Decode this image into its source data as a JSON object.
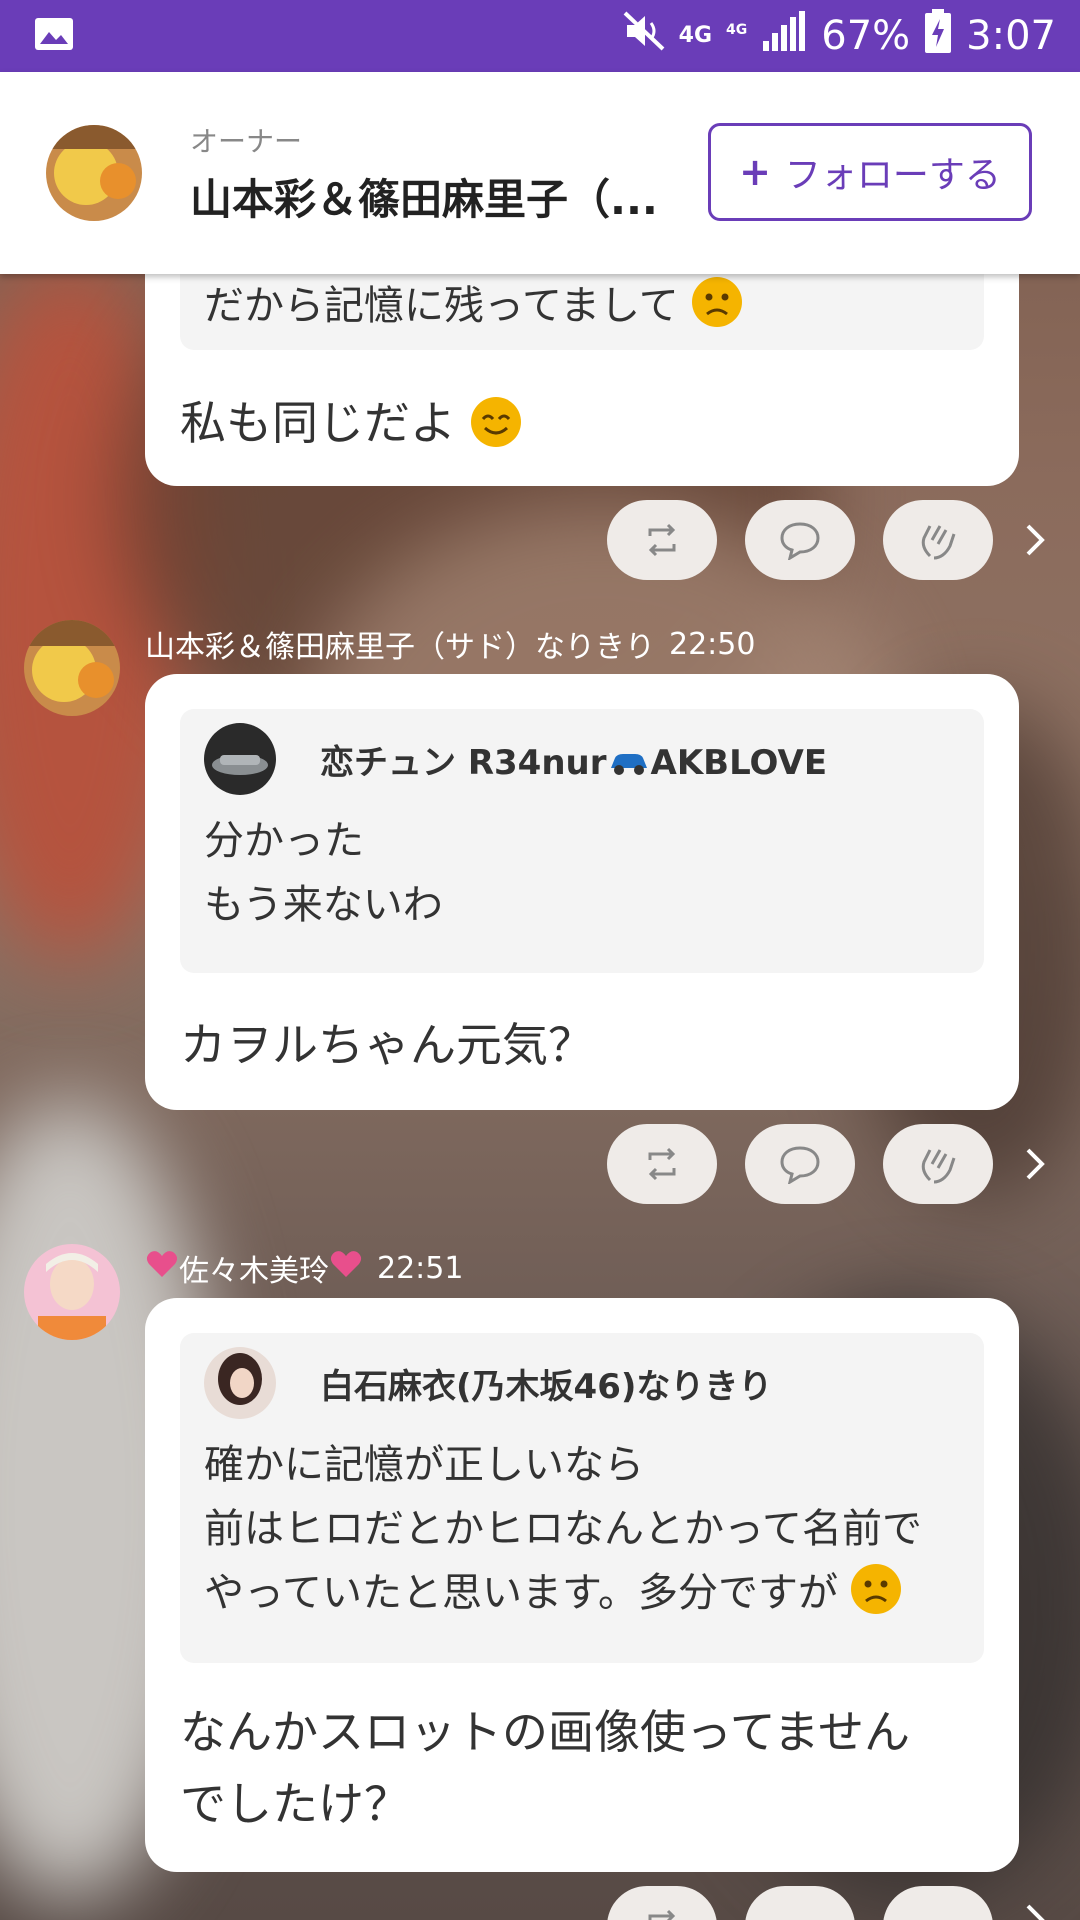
{
  "status_bar": {
    "network": "4G",
    "network_small": "4G",
    "battery": "67%",
    "time": "3:07"
  },
  "header": {
    "role": "オーナー",
    "title": "山本彩＆篠田麻里子（...",
    "follow_label": "フォローする"
  },
  "messages": [
    {
      "quote_tail": "だから記憶に残ってまして",
      "text": "私も同じだよ"
    },
    {
      "author": "山本彩＆篠田麻里子（サド）なりきり",
      "time": "22:50",
      "quote_author": "恋チュン R34nur",
      "quote_author_suffix": "AKBLOVE",
      "quote_lines": [
        "分かった",
        "もう来ないわ"
      ],
      "text": "カヲルちゃん元気？"
    },
    {
      "author": "佐々木美玲",
      "time": "22:51",
      "quote_author": "白石麻衣(乃木坂46)なりきり",
      "quote_lines": [
        "確かに記憶が正しいなら",
        "前はヒロだとかヒロなんとかって名前で",
        "やっていたと思います。多分ですが"
      ],
      "text_lines": [
        "なんかスロットの画像使ってません",
        "でしたけ？"
      ]
    }
  ],
  "icons": [
    "image-icon",
    "mute-icon",
    "signal-icon",
    "battery-icon",
    "repost-icon",
    "comment-icon",
    "clap-icon",
    "chevron-right-icon"
  ],
  "colors": {
    "accent": "#6a3db8",
    "card": "#ffffff",
    "quote_bg": "#f4f4f4"
  }
}
